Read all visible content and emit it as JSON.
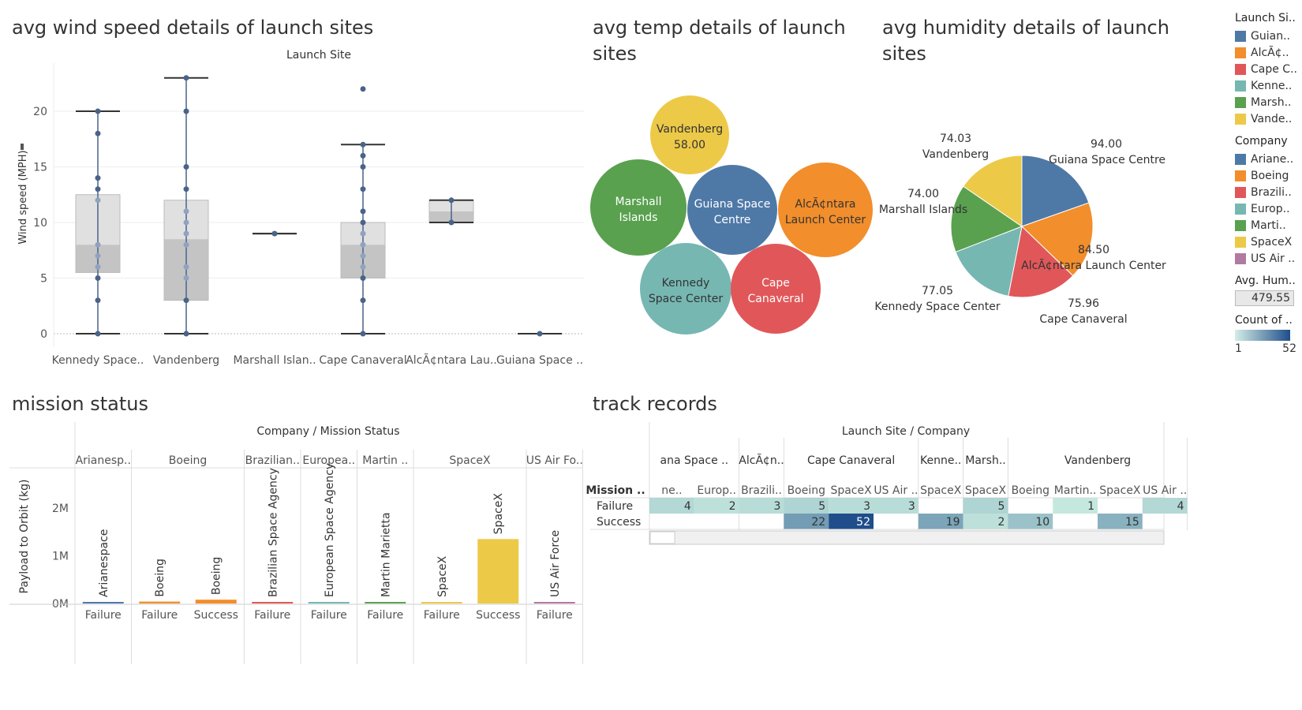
{
  "titles": {
    "wind": "avg wind speed details of launch sites",
    "temp": [
      "avg temp details of launch",
      "sites"
    ],
    "humidity": [
      "avg humidity details of launch",
      "sites"
    ],
    "mission": "mission status",
    "track": "track records"
  },
  "legend": {
    "launch_site_title": "Launch Si..",
    "launch_sites": [
      {
        "label": "Guian..",
        "color": "#4e79a7"
      },
      {
        "label": "AlcÃ¢..",
        "color": "#f28e2b"
      },
      {
        "label": "Cape C..",
        "color": "#e15759"
      },
      {
        "label": "Kenne..",
        "color": "#76b7b2"
      },
      {
        "label": "Marsh..",
        "color": "#59a14f"
      },
      {
        "label": "Vande..",
        "color": "#edc948"
      }
    ],
    "company_title": "Company",
    "companies": [
      {
        "label": "Ariane..",
        "color": "#4e79a7"
      },
      {
        "label": "Boeing",
        "color": "#f28e2b"
      },
      {
        "label": "Brazili..",
        "color": "#e15759"
      },
      {
        "label": "Europ..",
        "color": "#76b7b2"
      },
      {
        "label": "Marti..",
        "color": "#59a14f"
      },
      {
        "label": "SpaceX",
        "color": "#edc948"
      },
      {
        "label": "US Air ..",
        "color": "#b07aa1"
      }
    ],
    "avg_hum_title": "Avg. Hum..",
    "avg_hum_value": "479.55",
    "count_title": "Count of ..",
    "count_min": "1",
    "count_max": "52"
  },
  "chart_data": [
    {
      "id": "wind",
      "type": "box",
      "title": "avg wind speed details of launch sites",
      "header": "Launch Site",
      "ylabel": "Wind speed (MPH)",
      "ylim": [
        0,
        23
      ],
      "yticks": [
        0,
        5,
        10,
        15,
        20
      ],
      "categories": [
        {
          "label": "Kennedy Space..",
          "min": 0,
          "q1": 5.5,
          "median": 8,
          "q3": 12.5,
          "max": 20,
          "points": [
            0,
            3,
            5,
            6,
            7,
            8,
            12,
            13,
            14,
            18,
            20
          ]
        },
        {
          "label": "Vandenberg",
          "min": 0,
          "q1": 3,
          "median": 8.5,
          "q3": 12,
          "max": 23,
          "points": [
            0,
            3,
            5,
            6,
            8,
            9,
            10,
            11,
            13,
            15,
            20,
            23
          ]
        },
        {
          "label": "Marshall Islan..",
          "min": 9,
          "q1": 9,
          "median": 9,
          "q3": 9,
          "max": 9,
          "points": [
            9
          ]
        },
        {
          "label": "Cape Canaveral",
          "min": 0,
          "q1": 5,
          "median": 8,
          "q3": 10,
          "max": 17,
          "points": [
            0,
            3,
            5,
            6,
            7,
            8,
            9,
            10,
            11,
            13,
            15,
            16,
            17,
            22
          ]
        },
        {
          "label": "AlcÃ¢ntara Lau..",
          "min": 10,
          "q1": 10,
          "median": 11,
          "q3": 12,
          "max": 12,
          "points": [
            10,
            12
          ]
        },
        {
          "label": "Guiana Space ..",
          "min": 0,
          "q1": 0,
          "median": 0,
          "q3": 0,
          "max": 0,
          "points": [
            0
          ]
        }
      ]
    },
    {
      "id": "temp",
      "type": "bubble",
      "title": "avg temp details of launch sites",
      "bubbles": [
        {
          "label": [
            "Vandenberg",
            "58.00"
          ],
          "color": "#edc948",
          "text_color": "#333"
        },
        {
          "label": [
            "Marshall",
            "Islands"
          ],
          "color": "#59a14f",
          "text_color": "#fff"
        },
        {
          "label": [
            "Guiana Space",
            "Centre"
          ],
          "color": "#4e79a7",
          "text_color": "#fff"
        },
        {
          "label": [
            "AlcÃ¢ntara",
            "Launch Center"
          ],
          "color": "#f28e2b",
          "text_color": "#333"
        },
        {
          "label": [
            "Kennedy",
            "Space Center"
          ],
          "color": "#76b7b2",
          "text_color": "#333"
        },
        {
          "label": [
            "Cape",
            "Canaveral"
          ],
          "color": "#e15759",
          "text_color": "#fff"
        }
      ]
    },
    {
      "id": "humidity",
      "type": "pie",
      "title": "avg humidity details of launch sites",
      "slices": [
        {
          "label": "Guiana Space Centre",
          "value": 94.0,
          "value_text": "94.00",
          "color": "#4e79a7"
        },
        {
          "label": "AlcÃ¢ntara Launch Center",
          "value": 84.5,
          "value_text": "84.50",
          "color": "#f28e2b"
        },
        {
          "label": "Cape Canaveral",
          "value": 75.96,
          "value_text": "75.96",
          "color": "#e15759"
        },
        {
          "label": "Kennedy Space Center",
          "value": 77.05,
          "value_text": "77.05",
          "color": "#76b7b2"
        },
        {
          "label": "Marshall Islands",
          "value": 74.0,
          "value_text": "74.00",
          "color": "#59a14f"
        },
        {
          "label": "Vandenberg",
          "value": 74.03,
          "value_text": "74.03",
          "color": "#edc948"
        }
      ]
    },
    {
      "id": "mission",
      "type": "bar",
      "title": "mission status",
      "header": "Company / Mission Status",
      "ylabel": "Payload to Orbit (kg)",
      "ylim": [
        0,
        2800000
      ],
      "yticks": [
        {
          "v": 0,
          "t": "0M"
        },
        {
          "v": 1000000,
          "t": "1M"
        },
        {
          "v": 2000000,
          "t": "2M"
        }
      ],
      "groups": [
        {
          "company": "Arianesp..",
          "bars": [
            {
              "status": "Failure",
              "value": 20000,
              "color": "#4e79a7",
              "label": "Arianespace"
            }
          ]
        },
        {
          "company": "Boeing",
          "bars": [
            {
              "status": "Failure",
              "value": 40000,
              "color": "#f28e2b",
              "label": "Boeing"
            },
            {
              "status": "Success",
              "value": 80000,
              "color": "#f28e2b",
              "label": "Boeing"
            }
          ]
        },
        {
          "company": "Brazilian..",
          "bars": [
            {
              "status": "Failure",
              "value": 0,
              "color": "#e15759",
              "label": "Brazilian Space Agency"
            }
          ]
        },
        {
          "company": "Europea..",
          "bars": [
            {
              "status": "Failure",
              "value": 0,
              "color": "#76b7b2",
              "label": "European Space Agency"
            }
          ]
        },
        {
          "company": "Martin ..",
          "bars": [
            {
              "status": "Failure",
              "value": 0,
              "color": "#59a14f",
              "label": "Martin Marietta"
            }
          ]
        },
        {
          "company": "SpaceX",
          "bars": [
            {
              "status": "Failure",
              "value": 25000,
              "color": "#edc948",
              "label": "SpaceX"
            },
            {
              "status": "Success",
              "value": 1350000,
              "color": "#edc948",
              "label": "SpaceX"
            }
          ]
        },
        {
          "company": "US Air Fo..",
          "bars": [
            {
              "status": "Failure",
              "value": 30000,
              "color": "#b07aa1",
              "label": "US Air Force"
            }
          ]
        }
      ]
    },
    {
      "id": "track",
      "type": "heatmap",
      "title": "track records",
      "header": "Launch Site / Company",
      "row_header": "Mission ..",
      "color_range": [
        1,
        52
      ],
      "sites": [
        {
          "label": "ana Space ..",
          "companies": [
            "ne..",
            "Europ.."
          ]
        },
        {
          "label": "AlcÃ¢n..",
          "companies": [
            "Brazili.."
          ]
        },
        {
          "label": "Cape Canaveral",
          "companies": [
            "Boeing",
            "SpaceX",
            "US Air .."
          ]
        },
        {
          "label": "Kenne..",
          "companies": [
            "SpaceX"
          ]
        },
        {
          "label": "Marsh..",
          "companies": [
            "SpaceX"
          ]
        },
        {
          "label": "Vandenberg",
          "companies": [
            "Boeing",
            "Martin..",
            "SpaceX",
            "US Air .."
          ]
        }
      ],
      "rows": [
        {
          "status": "Failure",
          "values": [
            4,
            2,
            3,
            5,
            3,
            3,
            null,
            5,
            null,
            1,
            null,
            4
          ]
        },
        {
          "status": "Success",
          "values": [
            null,
            null,
            null,
            22,
            52,
            null,
            19,
            2,
            10,
            null,
            15,
            null
          ]
        }
      ]
    }
  ]
}
